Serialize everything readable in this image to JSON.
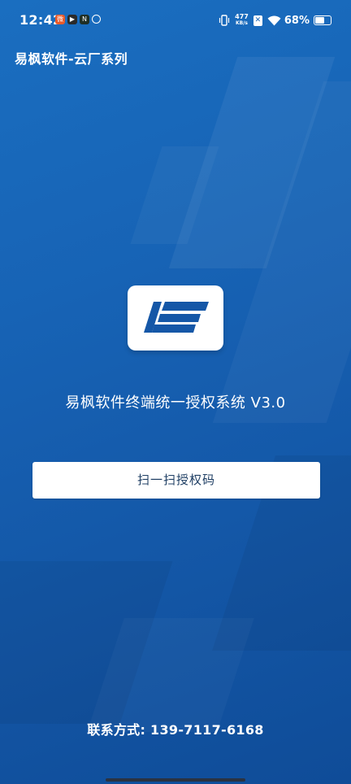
{
  "status_bar": {
    "time": "12:42",
    "net_speed_value": "477",
    "net_speed_unit": "KB/s",
    "battery": "68%",
    "battery_level": 0.68,
    "notification_icons": [
      "weibo-icon",
      "play-icon",
      "n-app-icon",
      "sync-icon"
    ],
    "sim_label": "✕"
  },
  "header": {
    "title": "易枫软件-云厂系列"
  },
  "main": {
    "system_title": "易枫软件终端统一授权系统 V3.0",
    "scan_button_label": "扫一扫授权码",
    "contact": "联系方式: 139-7117-6168"
  },
  "colors": {
    "background": "#1763b5",
    "logo_blue": "#1557a7",
    "button_text": "#1f3f64"
  }
}
